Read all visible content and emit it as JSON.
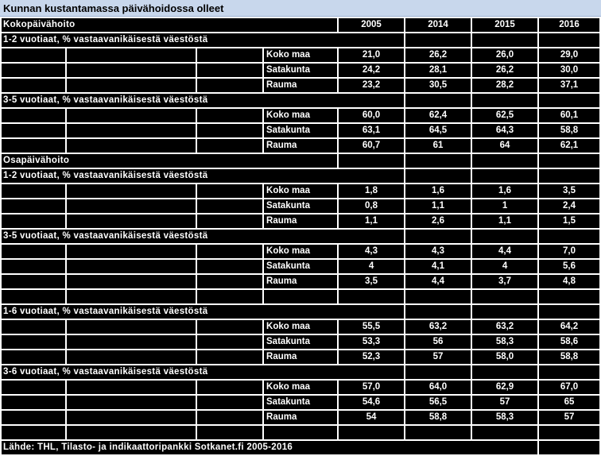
{
  "title": "Kunnan kustantamassa päivähoidossa olleet",
  "years": [
    "2005",
    "2014",
    "2015",
    "2016"
  ],
  "rows": [
    {
      "type": "section",
      "label": "Kokopäivähoito"
    },
    {
      "type": "group",
      "label": "1-2 vuotiaat, % vastaavanikäisestä väestöstä"
    },
    {
      "type": "data",
      "region": "Koko maa",
      "values": [
        "21,0",
        "26,2",
        "26,0",
        "29,0"
      ]
    },
    {
      "type": "data",
      "region": "Satakunta",
      "values": [
        "24,2",
        "28,1",
        "26,2",
        "30,0"
      ]
    },
    {
      "type": "data",
      "region": "Rauma",
      "values": [
        "23,2",
        "30,5",
        "28,2",
        "37,1"
      ]
    },
    {
      "type": "group",
      "label": "3-5 vuotiaat, % vastaavanikäisestä väestöstä"
    },
    {
      "type": "data",
      "region": "Koko maa",
      "values": "60,0|62,4|62,5|60,1"
    },
    {
      "type": "data",
      "region": "Satakunta",
      "values": "63,1|64,5|64,3|58,8"
    },
    {
      "type": "data",
      "region": "Rauma",
      "values": "60,7|61|64|62,1"
    },
    {
      "type": "section",
      "label": "Osapäivähoito"
    },
    {
      "type": "group",
      "label": "1-2 vuotiaat, % vastaavanikäisestä väestöstä"
    },
    {
      "type": "data",
      "region": "Koko maa",
      "values": "1,8|1,6|1,6|3,5"
    },
    {
      "type": "data",
      "region": "Satakunta",
      "values": "0,8|1,1|1|2,4"
    },
    {
      "type": "data",
      "region": "Rauma",
      "values": "1,1|2,6|1,1|1,5"
    },
    {
      "type": "group",
      "label": "3-5 vuotiaat, % vastaavanikäisestä väestöstä"
    },
    {
      "type": "data",
      "region": "Koko maa",
      "values": "4,3|4,3|4,4|7,0"
    },
    {
      "type": "data",
      "region": "Satakunta",
      "values": "4|4,1|4|5,6"
    },
    {
      "type": "data",
      "region": "Rauma",
      "values": "3,5|4,4|3,7|4,8"
    },
    {
      "type": "blank"
    },
    {
      "type": "group",
      "label": "1-6 vuotiaat, % vastaavanikäisestä väestöstä"
    },
    {
      "type": "data",
      "region": "Koko maa",
      "values": "55,5|63,2|63,2|64,2"
    },
    {
      "type": "data",
      "region": "Satakunta",
      "values": "53,3|56|58,3|58,6"
    },
    {
      "type": "data",
      "region": "Rauma",
      "values": "52,3|57|58,0|58,8"
    },
    {
      "type": "group",
      "label": "3-6 vuotiaat, % vastaavanikäisestä väestöstä"
    },
    {
      "type": "data",
      "region": "Koko maa",
      "values": "57,0|64,0|62,9|67,0"
    },
    {
      "type": "data",
      "region": "Satakunta",
      "values": "54,6|56,5|57|65"
    },
    {
      "type": "data",
      "region": "Rauma",
      "values": "54|58,8|58,3|57"
    },
    {
      "type": "blank"
    }
  ],
  "footer": "Lähde: THL, Tilasto- ja indikaattoripankki Sotkanet.fi 2005-2016"
}
